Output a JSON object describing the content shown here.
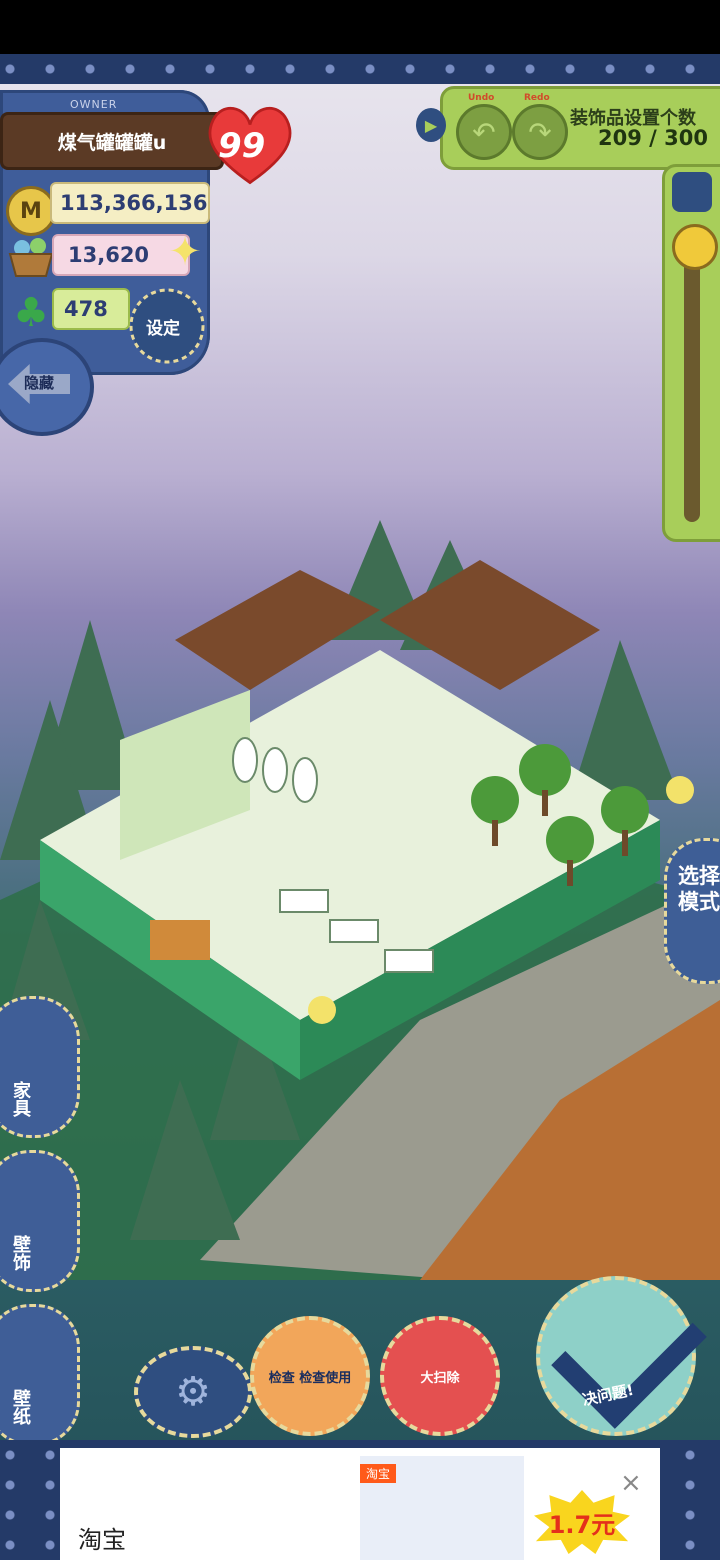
{
  "owner": {
    "label": "OWNER",
    "name": "煤气罐罐罐u",
    "level": "99"
  },
  "stats": {
    "coins": "113,366,136",
    "coin_symbol": "M",
    "produce": "13,620",
    "clover": "478"
  },
  "buttons": {
    "settings": "设定",
    "hide": "隐藏",
    "select_mode": "选择模式",
    "confirm": "决问题!"
  },
  "decor": {
    "undo_label": "Undo",
    "redo_label": "Redo",
    "title": "装饰品设置个数",
    "count": "209 / 300"
  },
  "side_tabs": [
    {
      "label": "家具"
    },
    {
      "label": "壁饰"
    },
    {
      "label": "壁纸"
    }
  ],
  "bottom": {
    "search_help": "检查 检查使用",
    "clean": "大扫除"
  },
  "ad": {
    "brand": "淘宝",
    "tag": "淘宝",
    "price": "1.7元",
    "close": "×"
  },
  "colors": {
    "panel_blue": "#3f5d9a",
    "panel_green": "#a8ce5a",
    "heart_red": "#e83a3a",
    "accent_cream": "#e7d99c"
  }
}
